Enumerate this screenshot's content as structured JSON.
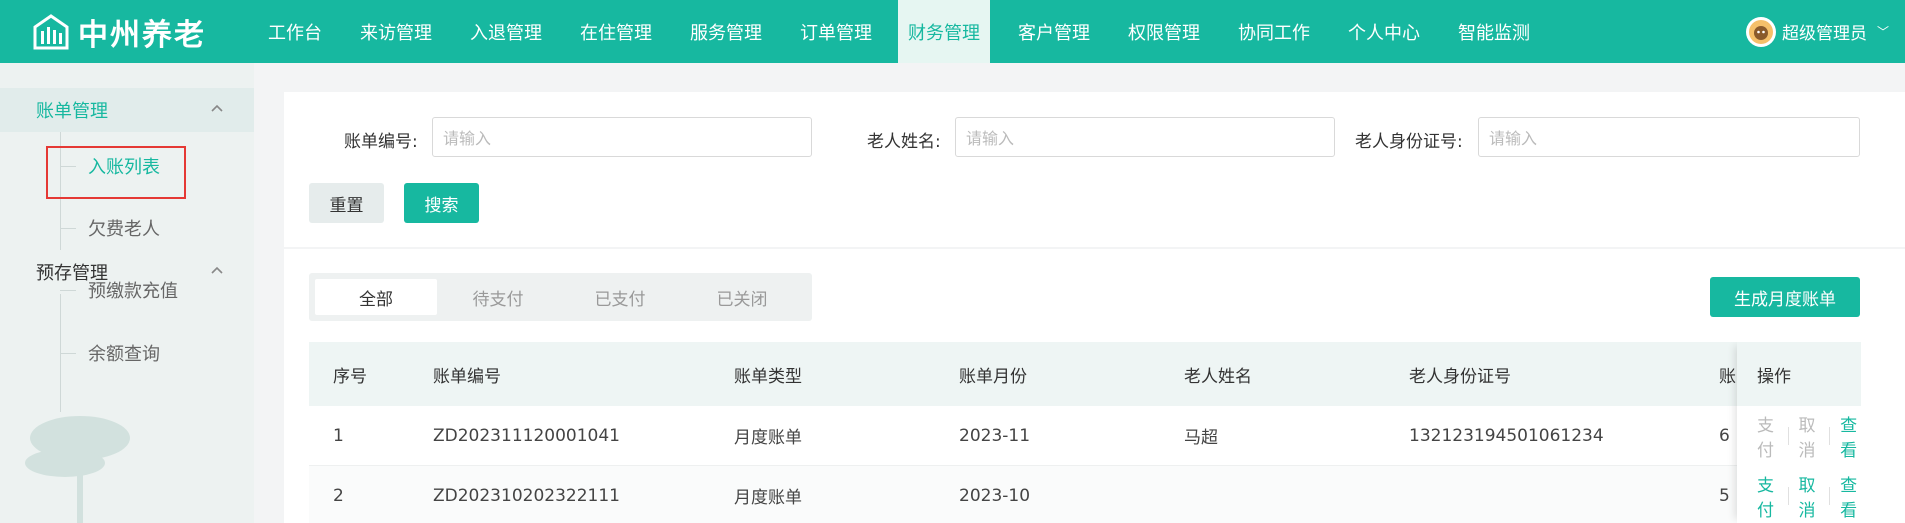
{
  "app": {
    "name": "中州养老",
    "accent": "#17b8a0"
  },
  "nav": {
    "items": [
      "工作台",
      "来访管理",
      "入退管理",
      "在住管理",
      "服务管理",
      "订单管理",
      "财务管理",
      "客户管理",
      "权限管理",
      "协同工作",
      "个人中心",
      "智能监测"
    ],
    "active": "财务管理"
  },
  "user": {
    "name": "超级管理员"
  },
  "sidebar": {
    "groups": [
      {
        "label": "账单管理",
        "items": [
          "入账列表",
          "欠费老人"
        ]
      },
      {
        "label": "预存管理",
        "items": [
          "预缴款充值",
          "余额查询"
        ]
      }
    ],
    "active_item": "入账列表"
  },
  "filters": {
    "bill_no_label": "账单编号:",
    "elder_name_label": "老人姓名:",
    "id_card_label": "老人身份证号:",
    "placeholder": "请输入",
    "reset_label": "重置",
    "search_label": "搜索"
  },
  "tabs": [
    "全部",
    "待支付",
    "已支付",
    "已关闭"
  ],
  "active_tab": "全部",
  "generate_button": "生成月度账单",
  "table": {
    "headers": [
      "序号",
      "账单编号",
      "账单类型",
      "账单月份",
      "老人姓名",
      "老人身份证号",
      "账",
      "操作"
    ],
    "rows": [
      {
        "index": "1",
        "bill_no": "ZD202311120001041",
        "type": "月度账单",
        "month": "2023-11",
        "name": "马超",
        "id_card": "132123194501061234",
        "amount_partial": "6",
        "ops": [
          "支付",
          "取消",
          "查看"
        ],
        "ops_enabled": [
          false,
          false,
          true
        ]
      },
      {
        "index": "2",
        "bill_no": "ZD202310202322111",
        "type": "月度账单",
        "month": "2023-10",
        "name": "",
        "id_card": "",
        "amount_partial": "5",
        "ops": [
          "支付",
          "取消",
          "查看"
        ],
        "ops_enabled": [
          true,
          true,
          true
        ]
      }
    ]
  }
}
